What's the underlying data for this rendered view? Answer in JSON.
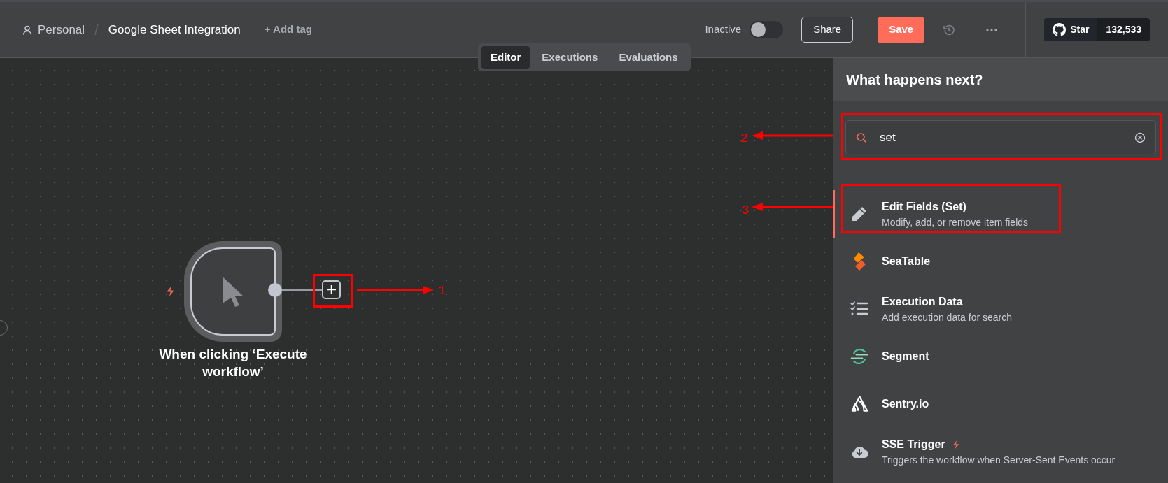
{
  "breadcrumb": {
    "project": "Personal",
    "separator": "/",
    "workflow": "Google Sheet Integration",
    "add_tag": "+ Add tag"
  },
  "view_tabs": [
    {
      "label": "Editor",
      "selected": true
    },
    {
      "label": "Executions",
      "selected": false
    },
    {
      "label": "Evaluations",
      "selected": false
    }
  ],
  "active_toggle": {
    "label": "Inactive",
    "on": false
  },
  "share": "Share",
  "save": "Save",
  "github": {
    "label": "Star",
    "count": "132,533"
  },
  "node": {
    "label": "When clicking ‘Execute workflow’",
    "trigger": true
  },
  "panel": {
    "title": "What happens next?",
    "search": {
      "value": "set"
    },
    "items": [
      {
        "name": "Edit Fields (Set)",
        "description": "Modify, add, or remove item fields",
        "selected": true,
        "trigger": false
      },
      {
        "name": "SeaTable",
        "selected": false,
        "trigger": false
      },
      {
        "name": "Execution Data",
        "description": "Add execution data for search",
        "selected": false,
        "trigger": false
      },
      {
        "name": "Segment",
        "selected": false,
        "trigger": false
      },
      {
        "name": "Sentry.io",
        "selected": false,
        "trigger": false
      },
      {
        "name": "SSE Trigger",
        "description": "Triggers the workflow when Server-Sent Events occur",
        "selected": false,
        "trigger": true
      }
    ]
  },
  "annotations": [
    {
      "label": "1"
    },
    {
      "label": "2"
    },
    {
      "label": "3"
    }
  ]
}
